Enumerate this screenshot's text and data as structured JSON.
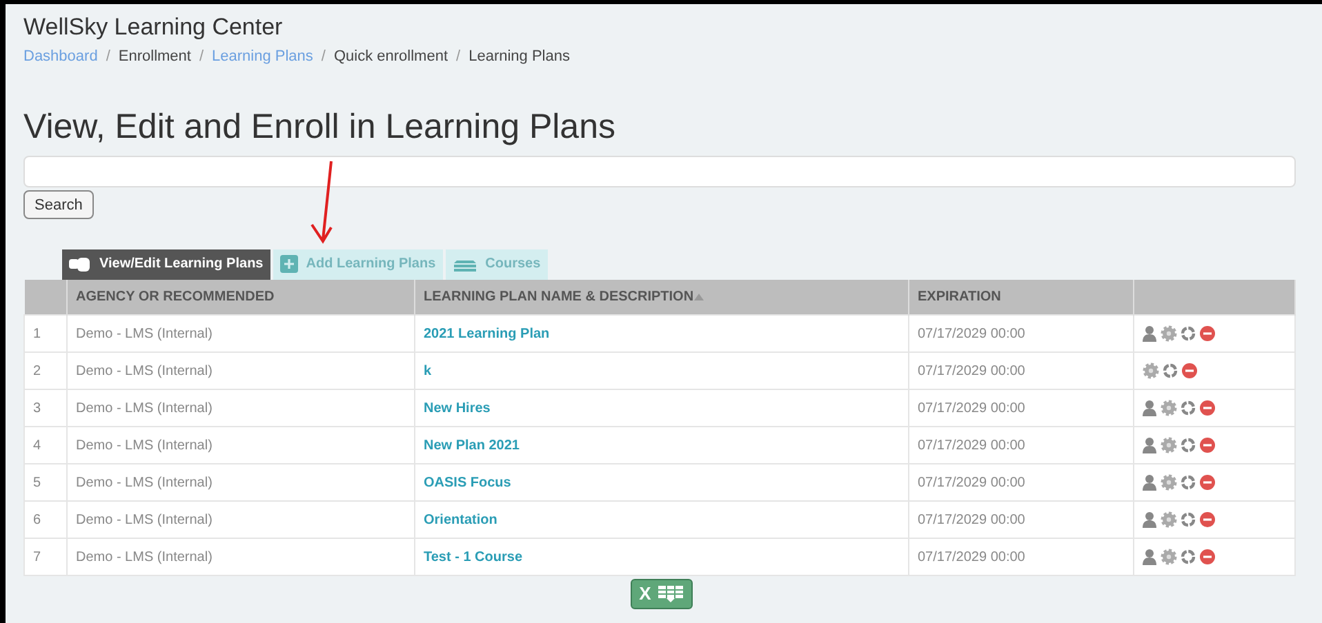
{
  "app_title": "WellSky Learning Center",
  "breadcrumb_separator": "/",
  "breadcrumbs": [
    {
      "label": "Dashboard",
      "link": true
    },
    {
      "label": "Enrollment",
      "link": false
    },
    {
      "label": "Learning Plans",
      "link": true
    },
    {
      "label": "Quick enrollment",
      "link": false
    },
    {
      "label": "Learning Plans",
      "link": false
    }
  ],
  "heading": "View, Edit and Enroll in Learning Plans",
  "search_button": "Search",
  "tabs": [
    {
      "label": "View/Edit Learning Plans",
      "kind": "view",
      "selected": true
    },
    {
      "label": "Add Learning Plans",
      "kind": "add",
      "selected": false
    },
    {
      "label": "Courses",
      "kind": "courses",
      "selected": false
    }
  ],
  "table": {
    "columns": [
      {
        "sorted": false
      },
      {
        "label": "AGENCY OR RECOMMENDED",
        "sorted": false
      },
      {
        "label": "LEARNING PLAN NAME & DESCRIPTION",
        "sorted": true
      },
      {
        "label": "EXPIRATION",
        "sorted": false
      },
      {
        "sorted": false
      }
    ],
    "rows": [
      {
        "number": "1",
        "agency": "Demo - LMS (Internal)",
        "plan": "2021 Learning Plan",
        "expiration": "07/17/2029 00:00",
        "can_enroll": true
      },
      {
        "number": "2",
        "agency": "Demo - LMS (Internal)",
        "plan": "k",
        "expiration": "07/17/2029 00:00",
        "can_enroll": false
      },
      {
        "number": "3",
        "agency": "Demo - LMS (Internal)",
        "plan": "New Hires",
        "expiration": "07/17/2029 00:00",
        "can_enroll": true
      },
      {
        "number": "4",
        "agency": "Demo - LMS (Internal)",
        "plan": "New Plan 2021",
        "expiration": "07/17/2029 00:00",
        "can_enroll": true
      },
      {
        "number": "5",
        "agency": "Demo - LMS (Internal)",
        "plan": "OASIS Focus",
        "expiration": "07/17/2029 00:00",
        "can_enroll": true
      },
      {
        "number": "6",
        "agency": "Demo - LMS (Internal)",
        "plan": "Orientation",
        "expiration": "07/17/2029 00:00",
        "can_enroll": true
      },
      {
        "number": "7",
        "agency": "Demo - LMS (Internal)",
        "plan": "Test - 1 Course",
        "expiration": "07/17/2029 00:00",
        "can_enroll": true
      }
    ]
  },
  "export_button": "X"
}
